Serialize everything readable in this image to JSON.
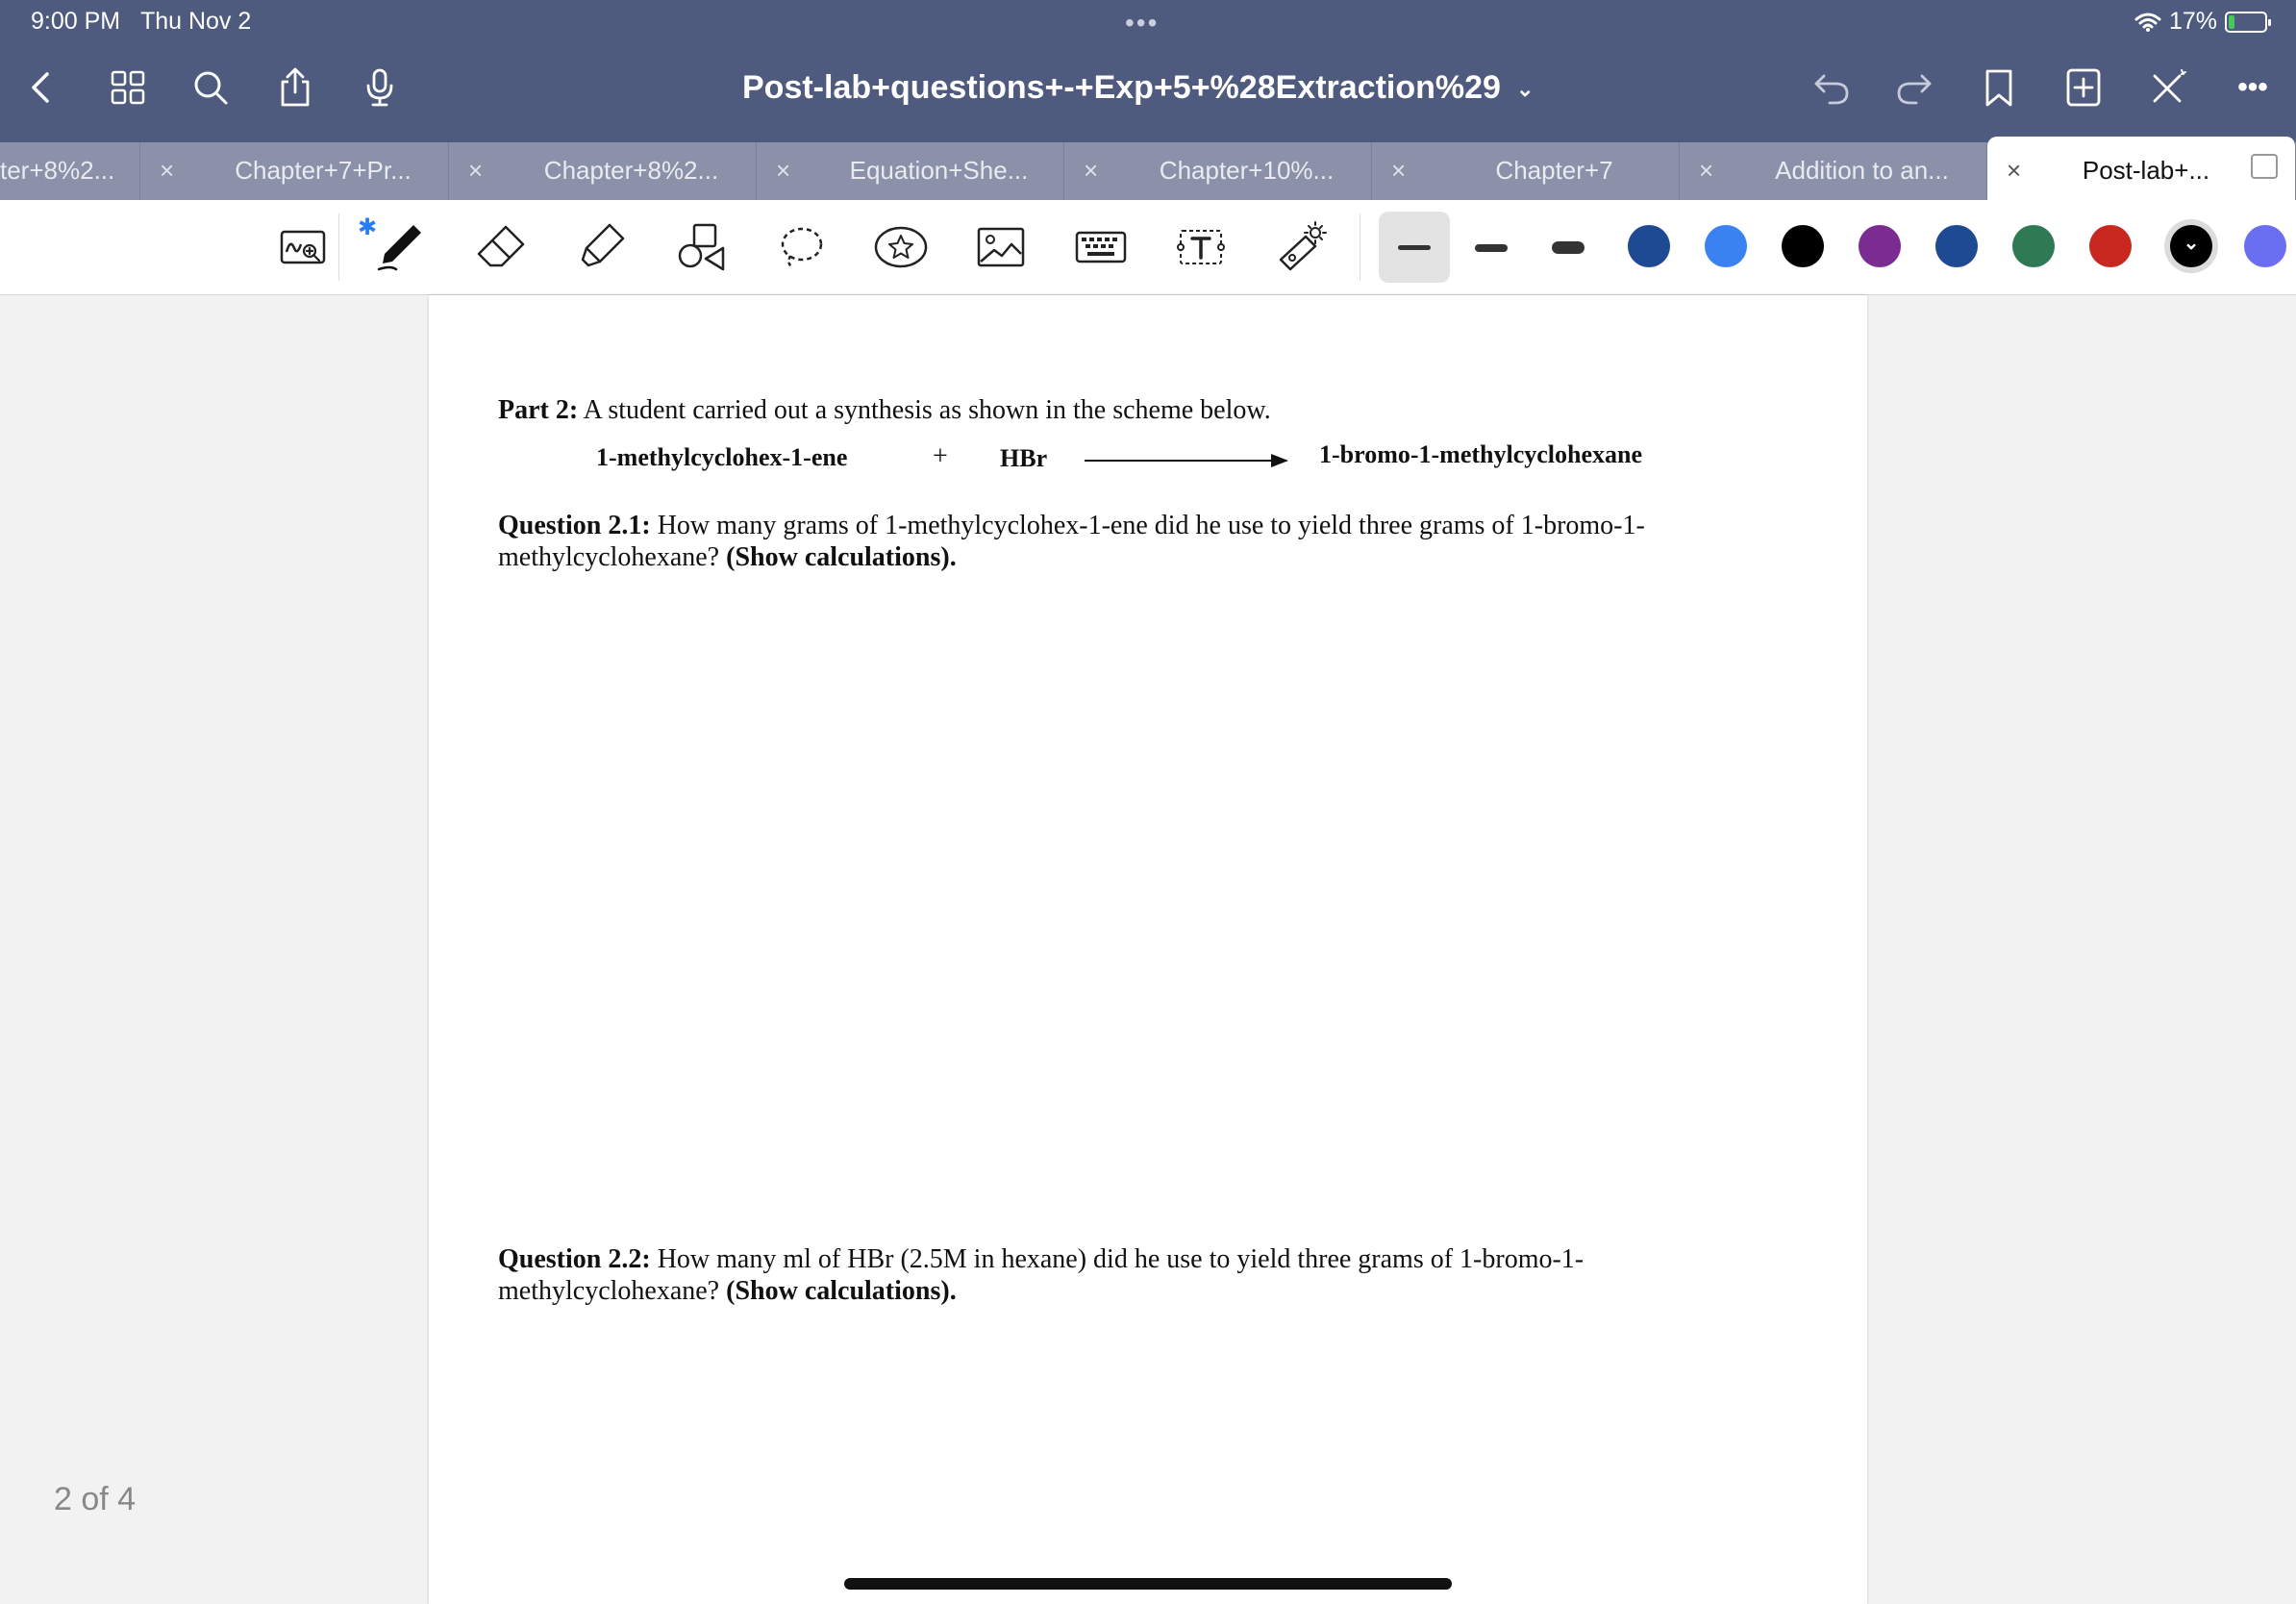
{
  "status_bar": {
    "time": "9:00 PM",
    "date": "Thu Nov 2",
    "center_dots": "•••",
    "battery_percent": "17%",
    "battery_level": 0.17,
    "charging": true
  },
  "nav": {
    "title": "Post-lab+questions+-+Exp+5+%28Extraction%29",
    "title_chevron": "⌄",
    "more": "•••",
    "icons": [
      "back-chevron-icon",
      "grid-icon",
      "search-icon",
      "share-icon",
      "microphone-icon",
      "undo-icon",
      "redo-icon",
      "bookmark-icon",
      "add-page-icon",
      "close-edit-icon",
      "more-icon"
    ]
  },
  "tabs": [
    {
      "label": "ter+8%2...",
      "active": false
    },
    {
      "label": "Chapter+7+Pr...",
      "active": false
    },
    {
      "label": "Chapter+8%2...",
      "active": false
    },
    {
      "label": "Equation+She...",
      "active": false
    },
    {
      "label": "Chapter+10%...",
      "active": false
    },
    {
      "label": "Chapter+7",
      "active": false
    },
    {
      "label": "Addition to an...",
      "active": false
    },
    {
      "label": "Post-lab+...",
      "active": true
    }
  ],
  "tab_close_glyph": "×",
  "toolbar": {
    "tools": [
      "handwriting-zoom-icon",
      "pen-icon",
      "eraser-icon",
      "highlighter-icon",
      "shapes-icon",
      "lasso-icon",
      "sticker-icon",
      "image-icon",
      "keyboard-icon",
      "text-box-icon",
      "laser-pointer-icon"
    ],
    "bluetooth_glyph": "✱",
    "stroke_widths": [
      "thin",
      "medium",
      "thick"
    ],
    "selected_stroke": "thin",
    "colors": [
      "#1e4a93",
      "#3a82f0",
      "#000000",
      "#7b2c90",
      "#1d4a90",
      "#2e7a55",
      "#c8281f",
      "#000000",
      "#6a6ef0"
    ],
    "selected_color_index": 7,
    "selected_color_glyph": "⌄"
  },
  "page_indicator": "2 of 4",
  "document": {
    "part_label": "Part 2:",
    "part_text": " A student carried out a synthesis as shown in the scheme below.",
    "scheme": {
      "reactant": "1-methylcyclohex-1-ene",
      "plus": "+",
      "reagent": "HBr",
      "product": "1-bromo-1-methylcyclohexane"
    },
    "q1": {
      "label": "Question 2.1:",
      "text1": " How many grams of 1-methylcyclohex-1-ene did he use to yield three grams of 1-bromo-1-",
      "text2": "methylcyclohexane? ",
      "bold_end": "(Show calculations)."
    },
    "q2": {
      "label": "Question 2.2:",
      "text1": " How many ml of HBr (2.5M in hexane) did he use to yield three grams of 1-bromo-1-",
      "text2": "methylcyclohexane? ",
      "bold_end": "(Show calculations)."
    }
  }
}
